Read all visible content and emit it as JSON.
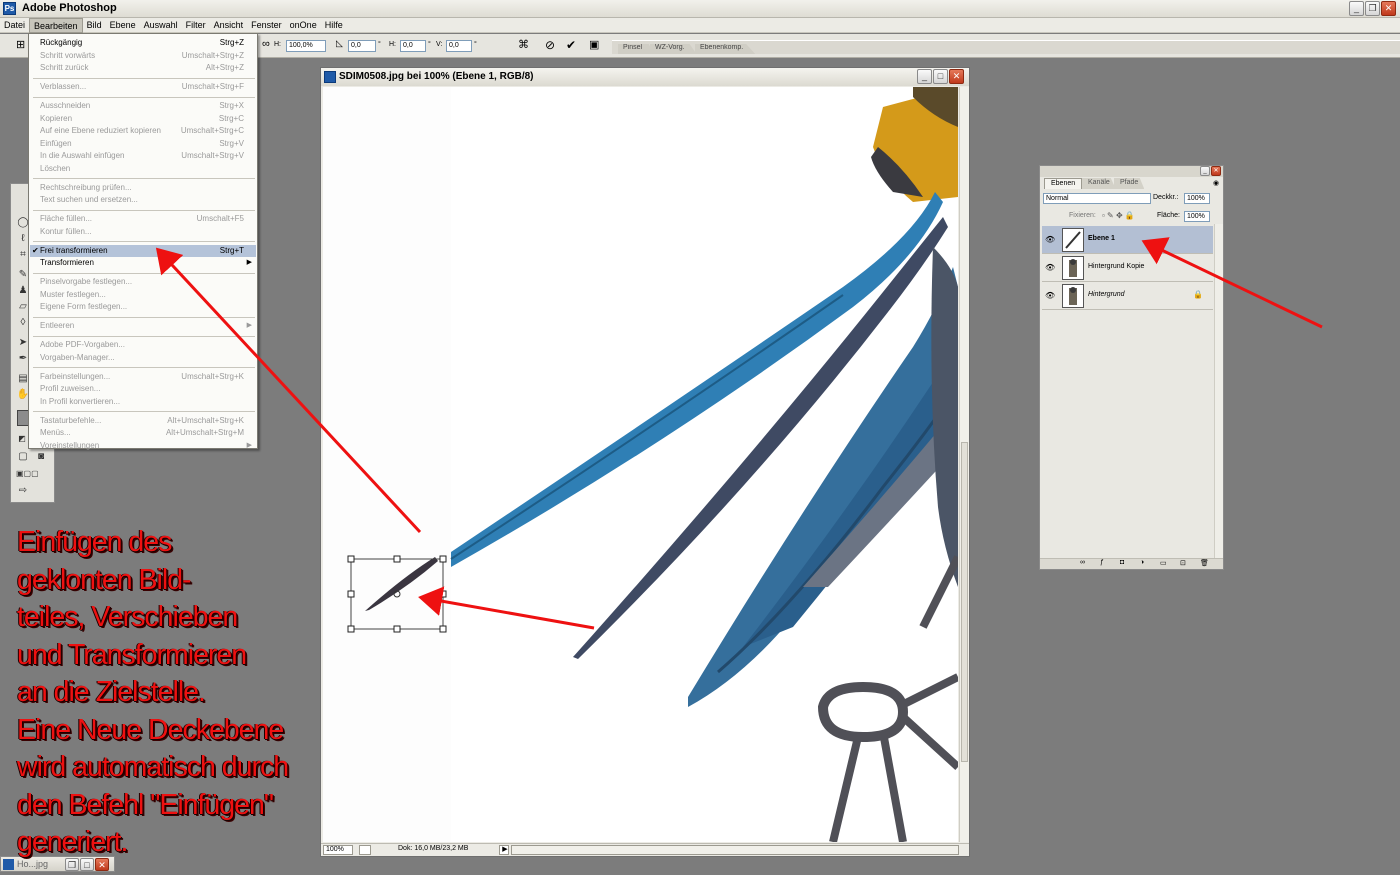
{
  "app": {
    "title": "Adobe Photoshop"
  },
  "menubar": [
    "Datei",
    "Bearbeiten",
    "Bild",
    "Ebene",
    "Auswahl",
    "Filter",
    "Ansicht",
    "Fenster",
    "onOne",
    "Hilfe"
  ],
  "options": {
    "h_label": "H:",
    "h_value": "100,0%",
    "angle_value": "0,0",
    "angle_unit": "°",
    "hskew_label": "H:",
    "hskew_value": "0,0",
    "hskew_unit": "°",
    "vskew_label": "V:",
    "vskew_value": "0,0",
    "vskew_unit": "°",
    "palette_tabs": [
      "Pinsel",
      "WZ-Vorg.",
      "Ebenenkomp."
    ]
  },
  "edit_menu": {
    "groups": [
      [
        {
          "label": "Rückgängig",
          "shortcut": "Strg+Z",
          "enabled": true
        },
        {
          "label": "Schritt vorwärts",
          "shortcut": "Umschalt+Strg+Z",
          "enabled": false
        },
        {
          "label": "Schritt zurück",
          "shortcut": "Alt+Strg+Z",
          "enabled": false
        }
      ],
      [
        {
          "label": "Verblassen...",
          "shortcut": "Umschalt+Strg+F",
          "enabled": false
        }
      ],
      [
        {
          "label": "Ausschneiden",
          "shortcut": "Strg+X",
          "enabled": false
        },
        {
          "label": "Kopieren",
          "shortcut": "Strg+C",
          "enabled": false
        },
        {
          "label": "Auf eine Ebene reduziert kopieren",
          "shortcut": "Umschalt+Strg+C",
          "enabled": false
        },
        {
          "label": "Einfügen",
          "shortcut": "Strg+V",
          "enabled": false
        },
        {
          "label": "In die Auswahl einfügen",
          "shortcut": "Umschalt+Strg+V",
          "enabled": false
        },
        {
          "label": "Löschen",
          "shortcut": "",
          "enabled": false
        }
      ],
      [
        {
          "label": "Rechtschreibung prüfen...",
          "shortcut": "",
          "enabled": false
        },
        {
          "label": "Text suchen und ersetzen...",
          "shortcut": "",
          "enabled": false
        }
      ],
      [
        {
          "label": "Fläche füllen...",
          "shortcut": "Umschalt+F5",
          "enabled": false
        },
        {
          "label": "Kontur füllen...",
          "shortcut": "",
          "enabled": false
        }
      ],
      [
        {
          "label": "Frei transformieren",
          "shortcut": "Strg+T",
          "enabled": true,
          "checked": true,
          "highlighted": true
        },
        {
          "label": "Transformieren",
          "shortcut": "",
          "enabled": true,
          "submenu": true
        }
      ],
      [
        {
          "label": "Pinselvorgabe festlegen...",
          "shortcut": "",
          "enabled": false
        },
        {
          "label": "Muster festlegen...",
          "shortcut": "",
          "enabled": false
        },
        {
          "label": "Eigene Form festlegen...",
          "shortcut": "",
          "enabled": false
        }
      ],
      [
        {
          "label": "Entleeren",
          "shortcut": "",
          "enabled": false,
          "submenu": true
        }
      ],
      [
        {
          "label": "Adobe PDF-Vorgaben...",
          "shortcut": "",
          "enabled": false
        },
        {
          "label": "Vorgaben-Manager...",
          "shortcut": "",
          "enabled": false
        }
      ],
      [
        {
          "label": "Farbeinstellungen...",
          "shortcut": "Umschalt+Strg+K",
          "enabled": false
        },
        {
          "label": "Profil zuweisen...",
          "shortcut": "",
          "enabled": false
        },
        {
          "label": "In Profil konvertieren...",
          "shortcut": "",
          "enabled": false
        }
      ],
      [
        {
          "label": "Tastaturbefehle...",
          "shortcut": "Alt+Umschalt+Strg+K",
          "enabled": false
        },
        {
          "label": "Menüs...",
          "shortcut": "Alt+Umschalt+Strg+M",
          "enabled": false
        },
        {
          "label": "Voreinstellungen",
          "shortcut": "",
          "enabled": false,
          "submenu": true
        }
      ]
    ]
  },
  "document": {
    "title": "SDIM0508.jpg bei 100% (Ebene 1, RGB/8)",
    "zoom": "100%",
    "doc_size": "Dok: 16,0 MB/23,2 MB"
  },
  "layers_palette": {
    "tabs": [
      "Ebenen",
      "Kanäle",
      "Pfade"
    ],
    "blend_mode": "Normal",
    "opacity_label": "Deckkr.:",
    "opacity_value": "100%",
    "lock_label": "Fixieren:",
    "fill_label": "Fläche:",
    "fill_value": "100%",
    "layers": [
      {
        "name": "Ebene 1",
        "selected": true,
        "locked": false
      },
      {
        "name": "Hintergrund Kopie",
        "selected": false,
        "locked": false
      },
      {
        "name": "Hintergrund",
        "selected": false,
        "locked": true
      }
    ]
  },
  "minimized_doc": {
    "title": "Ho...jpg"
  },
  "annotation": {
    "lines": [
      "Einfügen des",
      "geklonten Bild-",
      "teiles, Verschieben",
      "und Transformieren",
      "an die Zielstelle.",
      "Eine Neue Deckebene",
      "wird automatisch durch",
      "den Befehl \"Einfügen\"",
      "generiert."
    ],
    "color": "#ee1111"
  },
  "colors": {
    "feather_blue": "#2f7fb5",
    "beak_yellow": "#d49a1a",
    "arrow_red": "#ee1111"
  }
}
